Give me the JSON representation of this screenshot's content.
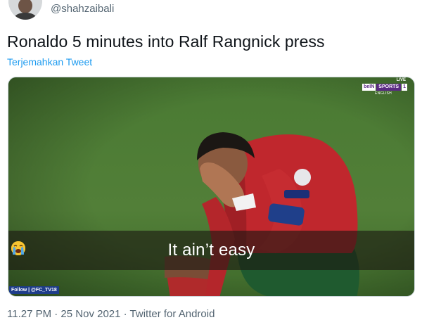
{
  "tweet": {
    "handle": "@shahzaibali",
    "text": "Ronaldo 5 minutes into Ralf Rangnick press",
    "translate_link": "Terjemahkan Tweet"
  },
  "media": {
    "caption": "It ain’t easy",
    "caption_emojis": [
      "loudly-crying-face",
      "loudly-crying-face",
      "loudly-crying-face"
    ],
    "broadcaster": {
      "live": "LIVE",
      "logo_left": "beIN",
      "logo_mid": "SPORTS",
      "logo_channel": "1",
      "language": "ENGLISH"
    },
    "watermark": "Follow | @FC_TV18"
  },
  "meta": "11.27 PM · 25 Nov 2021 · Twitter for Android",
  "colors": {
    "link": "#1d9bf0",
    "text": "#0f1419",
    "muted": "#536471",
    "pitch": "#4c7a34",
    "kit_red": "#c0272d"
  }
}
